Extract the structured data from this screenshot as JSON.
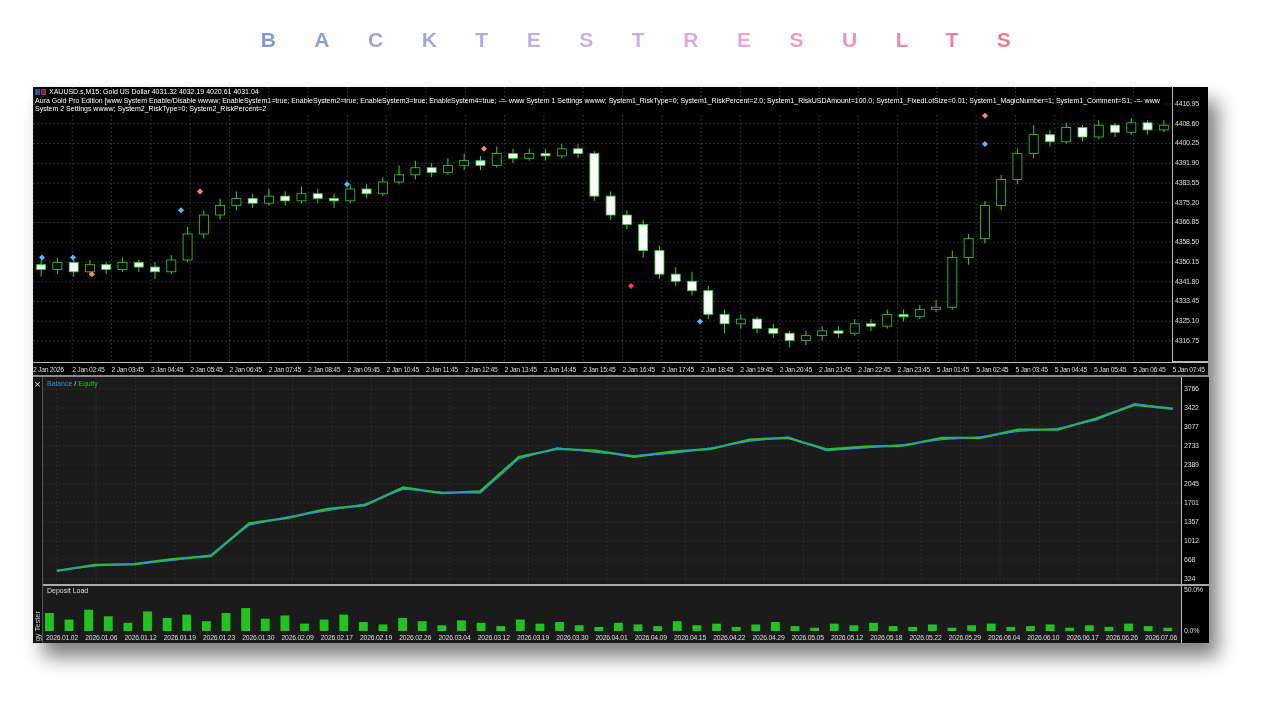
{
  "title": "BACKTEST RESULTS",
  "price_chart": {
    "symbol_line": "XAUUSD.s,M15:  Gold US Dollar  4031.32 4032.19 4020.61 4031.04",
    "settings_line": "Aura Gold Pro Edition [www System Enable/Disable wwww; EnableSystem1=true; EnableSystem2=true; EnableSystem3=true; EnableSystem4=true; -=- www System 1 Settings wwww; System1_RiskType=0; System1_RiskPercent=2.0; System1_RiskUSDAmount=100.0; System1_FixedLotSize=0.01; System1_MagicNumber=1; System1_Comment=S1; -=- www System 2 Settings wwww; System2_RiskType=0; System2_RiskPercent=2",
    "chart_data": {
      "type": "candlestick",
      "grid": true,
      "ylim": [
        4307.85,
        4424.14
      ],
      "yticks": [
        {
          "value": 4416.95,
          "label": "4416.95"
        },
        {
          "value": 4408.6,
          "label": "4408.60"
        },
        {
          "value": 4400.25,
          "label": "4400.25"
        },
        {
          "value": 4391.9,
          "label": "4391.90"
        },
        {
          "value": 4383.55,
          "label": "4383.55"
        },
        {
          "value": 4375.2,
          "label": "4375.20"
        },
        {
          "value": 4366.85,
          "label": "4366.85"
        },
        {
          "value": 4358.5,
          "label": "4358.50"
        },
        {
          "value": 4350.15,
          "label": "4350.15"
        },
        {
          "value": 4341.8,
          "label": "4341.80"
        },
        {
          "value": 4333.45,
          "label": "4333.45"
        },
        {
          "value": 4325.1,
          "label": "4325.10"
        },
        {
          "value": 4316.75,
          "label": "4316.75"
        }
      ],
      "categories": [
        null,
        null,
        null,
        null,
        null,
        null,
        null,
        null,
        null,
        null,
        null,
        null,
        null,
        null,
        null,
        null,
        null,
        null,
        null,
        null,
        null,
        null,
        null,
        null,
        null,
        null,
        null,
        null,
        null,
        null,
        null,
        null,
        null,
        null,
        null,
        null,
        null,
        null,
        null,
        null,
        null,
        null,
        null,
        null,
        null,
        null,
        null,
        null,
        null,
        null,
        null,
        null,
        null,
        null,
        null,
        null,
        null,
        null,
        null,
        null,
        null,
        null,
        null,
        null,
        null,
        null,
        null,
        null,
        null,
        null
      ],
      "ohlc": [
        [
          4349,
          4351,
          4344,
          4347
        ],
        [
          4347,
          4352,
          4345,
          4350
        ],
        [
          4350,
          4351,
          4344,
          4346
        ],
        [
          4346,
          4351,
          4344,
          4349
        ],
        [
          4349,
          4350,
          4345,
          4347
        ],
        [
          4347,
          4352,
          4346,
          4350
        ],
        [
          4350,
          4351,
          4346,
          4348
        ],
        [
          4348,
          4350,
          4343,
          4346
        ],
        [
          4346,
          4353,
          4345,
          4351
        ],
        [
          4351,
          4365,
          4350,
          4362
        ],
        [
          4362,
          4372,
          4360,
          4370
        ],
        [
          4370,
          4377,
          4368,
          4374
        ],
        [
          4374,
          4380,
          4372,
          4377
        ],
        [
          4377,
          4379,
          4373,
          4375
        ],
        [
          4375,
          4381,
          4374,
          4378
        ],
        [
          4378,
          4380,
          4374,
          4376
        ],
        [
          4376,
          4382,
          4375,
          4379
        ],
        [
          4379,
          4381,
          4375,
          4377
        ],
        [
          4377,
          4379,
          4373,
          4376
        ],
        [
          4376,
          4383,
          4375,
          4381
        ],
        [
          4381,
          4383,
          4377,
          4379
        ],
        [
          4379,
          4386,
          4378,
          4384
        ],
        [
          4384,
          4391,
          4383,
          4387
        ],
        [
          4387,
          4393,
          4385,
          4390
        ],
        [
          4390,
          4392,
          4386,
          4388
        ],
        [
          4388,
          4394,
          4387,
          4391
        ],
        [
          4391,
          4396,
          4389,
          4393
        ],
        [
          4393,
          4395,
          4389,
          4391
        ],
        [
          4391,
          4399,
          4390,
          4396
        ],
        [
          4396,
          4398,
          4392,
          4394
        ],
        [
          4394,
          4398,
          4393,
          4396
        ],
        [
          4396,
          4398,
          4393,
          4395
        ],
        [
          4395,
          4400,
          4394,
          4398
        ],
        [
          4398,
          4400,
          4394,
          4396
        ],
        [
          4396,
          4397,
          4376,
          4378
        ],
        [
          4378,
          4380,
          4368,
          4370
        ],
        [
          4370,
          4372,
          4364,
          4366
        ],
        [
          4366,
          4368,
          4352,
          4355
        ],
        [
          4355,
          4357,
          4343,
          4345
        ],
        [
          4345,
          4348,
          4340,
          4342
        ],
        [
          4342,
          4346,
          4336,
          4338
        ],
        [
          4338,
          4340,
          4326,
          4328
        ],
        [
          4328,
          4330,
          4320,
          4324
        ],
        [
          4324,
          4328,
          4322,
          4326
        ],
        [
          4326,
          4327,
          4320,
          4322
        ],
        [
          4322,
          4324,
          4318,
          4320
        ],
        [
          4320,
          4321,
          4314,
          4317
        ],
        [
          4317,
          4321,
          4315,
          4319
        ],
        [
          4319,
          4323,
          4317,
          4321
        ],
        [
          4321,
          4323,
          4318,
          4320
        ],
        [
          4320,
          4326,
          4319,
          4324
        ],
        [
          4324,
          4326,
          4321,
          4323
        ],
        [
          4323,
          4330,
          4322,
          4328
        ],
        [
          4328,
          4330,
          4325,
          4327
        ],
        [
          4327,
          4332,
          4326,
          4330
        ],
        [
          4330,
          4334,
          4329,
          4331
        ],
        [
          4331,
          4355,
          4330,
          4352
        ],
        [
          4352,
          4362,
          4349,
          4360
        ],
        [
          4360,
          4376,
          4358,
          4374
        ],
        [
          4374,
          4387,
          4372,
          4385
        ],
        [
          4385,
          4398,
          4383,
          4396
        ],
        [
          4396,
          4408,
          4394,
          4404
        ],
        [
          4404,
          4406,
          4399,
          4401
        ],
        [
          4401,
          4409,
          4400,
          4407
        ],
        [
          4407,
          4408,
          4401,
          4403
        ],
        [
          4403,
          4410,
          4402,
          4408
        ],
        [
          4408,
          4409,
          4403,
          4405
        ],
        [
          4405,
          4411,
          4404,
          4409
        ],
        [
          4409,
          4410,
          4404,
          4406
        ],
        [
          4406,
          4410,
          4405,
          4408
        ]
      ]
    },
    "time_axis": [
      "2 Jan 2026",
      "2 Jan 02:45",
      "2 Jan 03:45",
      "2 Jan 04:45",
      "2 Jan 05:45",
      "2 Jan 06:45",
      "2 Jan 07:45",
      "2 Jan 08:45",
      "2 Jan 09:45",
      "2 Jan 10:45",
      "2 Jan 11:45",
      "2 Jan 12:45",
      "2 Jan 13:45",
      "2 Jan 14:45",
      "2 Jan 15:45",
      "2 Jan 16:45",
      "2 Jan 17:45",
      "2 Jan 18:45",
      "2 Jan 19:45",
      "2 Jan 20:45",
      "2 Jan 21:45",
      "2 Jan 22:45",
      "2 Jan 23:45",
      "5 Jan 01:45",
      "5 Jan 02:45",
      "5 Jan 03:45",
      "5 Jan 04:45",
      "5 Jan 05:45",
      "5 Jan 06:45",
      "5 Jan 07:45"
    ]
  },
  "tester": {
    "close_button": "×",
    "side_label": "gy Tester",
    "balance_chart": {
      "legend_separator": "/",
      "chart_data": {
        "type": "line",
        "grid": true,
        "categories": [
          null,
          null,
          null,
          null,
          null,
          null,
          null,
          null,
          null,
          null,
          null,
          null,
          null,
          null,
          null,
          null,
          null,
          null,
          null,
          null,
          null,
          null,
          null,
          null,
          null,
          null,
          null,
          null,
          null,
          null
        ],
        "ylim": [
          324,
          3766
        ],
        "yticks": [
          {
            "value": 3766,
            "label": "3766"
          },
          {
            "value": 3422,
            "label": "3422"
          },
          {
            "value": 3077,
            "label": "3077"
          },
          {
            "value": 2733,
            "label": "2733"
          },
          {
            "value": 2389,
            "label": "2389"
          },
          {
            "value": 2045,
            "label": "2045"
          },
          {
            "value": 1701,
            "label": "1701"
          },
          {
            "value": 1357,
            "label": "1357"
          },
          {
            "value": 1012,
            "label": "1012"
          },
          {
            "value": 668,
            "label": "668"
          },
          {
            "value": 324,
            "label": "324"
          }
        ],
        "series": [
          {
            "name": "Balance",
            "color": "#2f8fdc",
            "values": [
              480,
              560,
              600,
              660,
              760,
              1300,
              1450,
              1560,
              1680,
              1950,
              1900,
              1880,
              2500,
              2700,
              2620,
              2560,
              2600,
              2700,
              2820,
              2900,
              2650,
              2700,
              2760,
              2850,
              2900,
              3000,
              3050,
              3200,
              3500,
              3400
            ]
          },
          {
            "name": "Equity",
            "color": "#22c322",
            "values": [
              470,
              580,
              590,
              680,
              740,
              1330,
              1430,
              1590,
              1660,
              1980,
              1880,
              1910,
              2530,
              2680,
              2650,
              2540,
              2630,
              2680,
              2850,
              2880,
              2670,
              2720,
              2740,
              2880,
              2880,
              3030,
              3030,
              3230,
              3480,
              3410
            ]
          }
        ]
      }
    },
    "deposit_chart": {
      "title": "Deposit Load",
      "chart_data": {
        "type": "bar",
        "ylim": [
          0,
          55
        ],
        "yticks": [
          {
            "value": 50,
            "label": "50.0%"
          },
          {
            "value": 0,
            "label": "0.0%"
          }
        ],
        "series": [
          {
            "color": "#1fc41f",
            "values": [
              22,
              14,
              26,
              18,
              10,
              24,
              16,
              20,
              12,
              22,
              28,
              15,
              19,
              9,
              14,
              20,
              11,
              8,
              16,
              12,
              7,
              13,
              10,
              6,
              14,
              9,
              11,
              7,
              5,
              10,
              8,
              6,
              12,
              7,
              9,
              5,
              8,
              11,
              6,
              4,
              9,
              7,
              10,
              6,
              5,
              8,
              4,
              7,
              9,
              5,
              6,
              8,
              4,
              7,
              5,
              9,
              6,
              4
            ]
          }
        ]
      }
    },
    "date_axis": [
      "2026.01.02",
      "2026.01.06",
      "2026.01.12",
      "2026.01.19",
      "2026.01.23",
      "2026.01.30",
      "2026.02.09",
      "2026.02.17",
      "2026.02.19",
      "2026.02.26",
      "2026.03.04",
      "2026.03.12",
      "2026.03.19",
      "2026.03.30",
      "2026.04.01",
      "2026.04.09",
      "2026.04.15",
      "2026.04.22",
      "2026.04.29",
      "2026.05.05",
      "2026.05.12",
      "2026.05.18",
      "2026.05.22",
      "2026.05.29",
      "2026.06.04",
      "2026.06.10",
      "2026.06.17",
      "2026.06.26",
      "2026.07.06"
    ]
  }
}
